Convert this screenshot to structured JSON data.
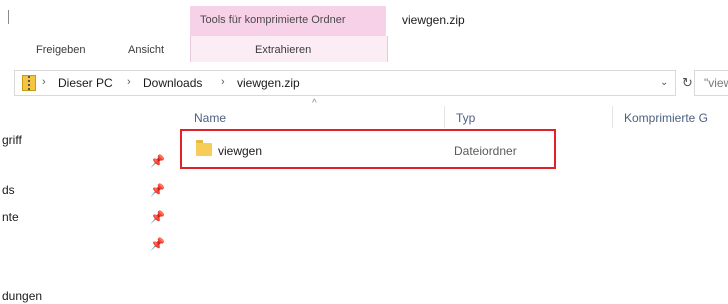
{
  "ribbon": {
    "context_group": "Tools für komprimierte Ordner",
    "window_title": "viewgen.zip",
    "tabs": [
      "Freigeben",
      "Ansicht"
    ],
    "context_tab": "Extrahieren"
  },
  "address": {
    "crumbs": [
      "Dieser PC",
      "Downloads",
      "viewgen.zip"
    ],
    "search_placeholder": "\"view"
  },
  "nav": {
    "items": [
      "griff",
      "ds",
      "nte",
      "dungen"
    ]
  },
  "columns": {
    "name": "Name",
    "type": "Typ",
    "compressed": "Komprimierte G"
  },
  "rows": [
    {
      "name": "viewgen",
      "type": "Dateiordner"
    }
  ],
  "icons": {
    "zip": "zip-folder-icon",
    "folder": "folder-icon",
    "pin": "pin-icon",
    "refresh": "refresh-icon",
    "dropdown": "chevron-down-icon",
    "sort": "sort-up-icon"
  },
  "colors": {
    "context_tab": "#f7d1e7",
    "selection_outline": "#e0202a",
    "folder": "#f6cd58"
  }
}
